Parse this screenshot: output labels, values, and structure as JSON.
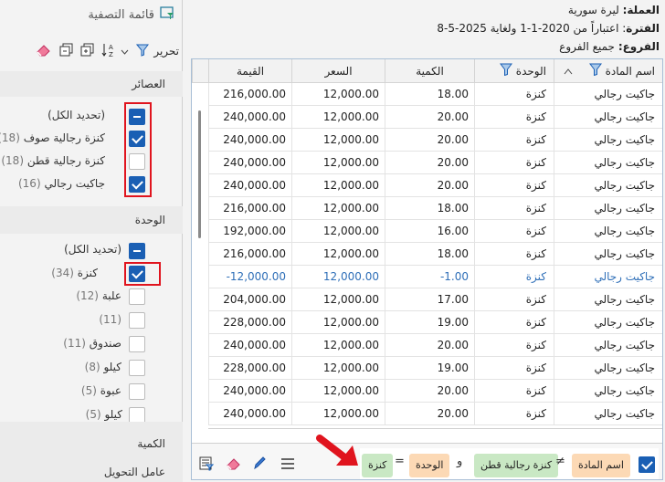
{
  "filter_panel": {
    "title": "قائمة التصفية",
    "toolbar": {
      "edit_label": "تحرير"
    },
    "sections": [
      {
        "title": "العصائر",
        "items": [
          {
            "label": "(تحديد الكل)",
            "count": "",
            "state": "indeterminate"
          },
          {
            "label": "كنزة رجالية صوف",
            "count": "(18)",
            "state": "checked"
          },
          {
            "label": "كنزة رجالية قطن",
            "count": "(18)",
            "state": "unchecked"
          },
          {
            "label": "جاكيت رجالي",
            "count": "(16)",
            "state": "checked"
          }
        ]
      },
      {
        "title": "الوحدة",
        "items": [
          {
            "label": "(تحديد الكل)",
            "count": "",
            "state": "indeterminate"
          },
          {
            "label": "كنزة",
            "count": "(34)",
            "state": "checked"
          },
          {
            "label": "علبة",
            "count": "(12)",
            "state": "unchecked"
          },
          {
            "label": "",
            "count": "(11)",
            "state": "unchecked"
          },
          {
            "label": "صندوق",
            "count": "(11)",
            "state": "unchecked"
          },
          {
            "label": "كيلو",
            "count": "(8)",
            "state": "unchecked"
          },
          {
            "label": "عبوة",
            "count": "(5)",
            "state": "unchecked"
          },
          {
            "label": "كيلو",
            "count": "(5)",
            "state": "unchecked"
          }
        ]
      },
      {
        "title": "الكمية",
        "items": []
      },
      {
        "title": "عامل التحويل",
        "items": []
      }
    ]
  },
  "report_info": {
    "currency_label": "العملة:",
    "currency_value": "ليرة سورية",
    "period_label": "الفترة",
    "period_value": ": اعتباراً من 2020-1-1 ولغاية 2025-5-8",
    "branches_label": "الفروع:",
    "branches_value": "جميع الفروع"
  },
  "grid": {
    "columns": {
      "item_name": "اسم المادة",
      "unit": "الوحدة",
      "qty": "الكمية",
      "price": "السعر",
      "value": "القيمة"
    },
    "rows": [
      {
        "name": "جاكيت رجالي",
        "unit": "كنزة",
        "qty": "18.00",
        "price": "12,000.00",
        "value": "216,000.00"
      },
      {
        "name": "جاكيت رجالي",
        "unit": "كنزة",
        "qty": "20.00",
        "price": "12,000.00",
        "value": "240,000.00"
      },
      {
        "name": "جاكيت رجالي",
        "unit": "كنزة",
        "qty": "20.00",
        "price": "12,000.00",
        "value": "240,000.00"
      },
      {
        "name": "جاكيت رجالي",
        "unit": "كنزة",
        "qty": "20.00",
        "price": "12,000.00",
        "value": "240,000.00"
      },
      {
        "name": "جاكيت رجالي",
        "unit": "كنزة",
        "qty": "20.00",
        "price": "12,000.00",
        "value": "240,000.00"
      },
      {
        "name": "جاكيت رجالي",
        "unit": "كنزة",
        "qty": "18.00",
        "price": "12,000.00",
        "value": "216,000.00"
      },
      {
        "name": "جاكيت رجالي",
        "unit": "كنزة",
        "qty": "16.00",
        "price": "12,000.00",
        "value": "192,000.00"
      },
      {
        "name": "جاكيت رجالي",
        "unit": "كنزة",
        "qty": "18.00",
        "price": "12,000.00",
        "value": "216,000.00"
      },
      {
        "name": "جاكيت رجالي",
        "unit": "كنزة",
        "qty": "-1.00",
        "price": "12,000.00",
        "value": "-12,000.00"
      },
      {
        "name": "جاكيت رجالي",
        "unit": "كنزة",
        "qty": "17.00",
        "price": "12,000.00",
        "value": "204,000.00"
      },
      {
        "name": "جاكيت رجالي",
        "unit": "كنزة",
        "qty": "19.00",
        "price": "12,000.00",
        "value": "228,000.00"
      },
      {
        "name": "جاكيت رجالي",
        "unit": "كنزة",
        "qty": "20.00",
        "price": "12,000.00",
        "value": "240,000.00"
      },
      {
        "name": "جاكيت رجالي",
        "unit": "كنزة",
        "qty": "19.00",
        "price": "12,000.00",
        "value": "228,000.00"
      },
      {
        "name": "جاكيت رجالي",
        "unit": "كنزة",
        "qty": "20.00",
        "price": "12,000.00",
        "value": "240,000.00"
      },
      {
        "name": "جاكيت رجالي",
        "unit": "كنزة",
        "qty": "20.00",
        "price": "12,000.00",
        "value": "240,000.00"
      }
    ]
  },
  "filter_bar": {
    "field1": "اسم المادة",
    "op1": "≠",
    "value1": "كنزة رجالية قطن",
    "connector": "و",
    "field2": "الوحدة",
    "op2": "=",
    "value2": "كنزة"
  },
  "colors": {
    "accent": "#1a5fb4",
    "highlight": "#e0141e",
    "negative_row": "#2f6fb8"
  }
}
